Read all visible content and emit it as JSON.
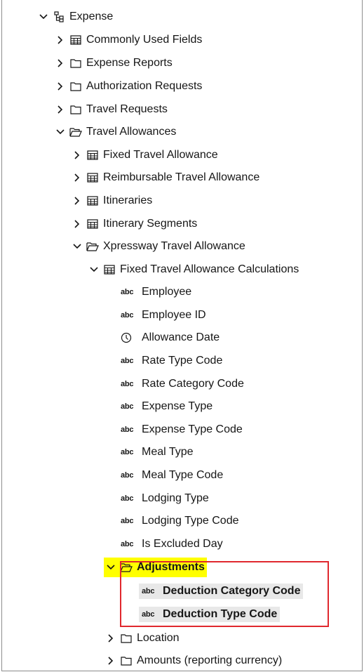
{
  "tree": {
    "root": {
      "label": "Expense",
      "icon": "hierarchy-icon"
    },
    "level1": [
      {
        "label": "Commonly Used Fields",
        "icon": "table-icon",
        "state": "collapsed"
      },
      {
        "label": "Expense Reports",
        "icon": "folder-icon",
        "state": "collapsed"
      },
      {
        "label": "Authorization Requests",
        "icon": "folder-icon",
        "state": "collapsed"
      },
      {
        "label": "Travel Requests",
        "icon": "folder-icon",
        "state": "collapsed"
      },
      {
        "label": "Travel Allowances",
        "icon": "folder-open-icon",
        "state": "expanded"
      }
    ],
    "travel_allowances": [
      {
        "label": "Fixed Travel Allowance",
        "icon": "table-icon",
        "state": "collapsed"
      },
      {
        "label": "Reimbursable Travel Allowance",
        "icon": "table-icon",
        "state": "collapsed"
      },
      {
        "label": "Itineraries",
        "icon": "table-icon",
        "state": "collapsed"
      },
      {
        "label": "Itinerary Segments",
        "icon": "table-icon",
        "state": "collapsed"
      },
      {
        "label": "Xpressway Travel Allowance",
        "icon": "folder-open-icon",
        "state": "expanded"
      }
    ],
    "xpressway": {
      "label": "Fixed Travel Allowance Calculations",
      "icon": "table-icon",
      "state": "expanded"
    },
    "fields": [
      {
        "type": "abc",
        "label": "Employee"
      },
      {
        "type": "abc",
        "label": "Employee ID"
      },
      {
        "type": "clock",
        "label": "Allowance Date"
      },
      {
        "type": "abc",
        "label": "Rate Type Code"
      },
      {
        "type": "abc",
        "label": "Rate Category Code"
      },
      {
        "type": "abc",
        "label": "Expense Type"
      },
      {
        "type": "abc",
        "label": "Expense Type Code"
      },
      {
        "type": "abc",
        "label": "Meal Type"
      },
      {
        "type": "abc",
        "label": "Meal Type Code"
      },
      {
        "type": "abc",
        "label": "Lodging Type"
      },
      {
        "type": "abc",
        "label": "Lodging Type Code"
      },
      {
        "type": "abc",
        "label": "Is Excluded Day"
      }
    ],
    "adjustments": {
      "label": "Adjustments",
      "icon": "folder-open-icon",
      "state": "expanded",
      "highlight": "#ffff00"
    },
    "adjustment_fields": [
      {
        "type": "abc",
        "label": "Deduction Category Code"
      },
      {
        "type": "abc",
        "label": "Deduction Type Code"
      }
    ],
    "after": [
      {
        "label": "Location",
        "icon": "folder-icon",
        "state": "collapsed"
      },
      {
        "label": "Amounts (reporting currency)",
        "icon": "folder-icon",
        "state": "collapsed"
      }
    ],
    "abc_glyph": "abc",
    "selection_color": "#e0282e"
  }
}
